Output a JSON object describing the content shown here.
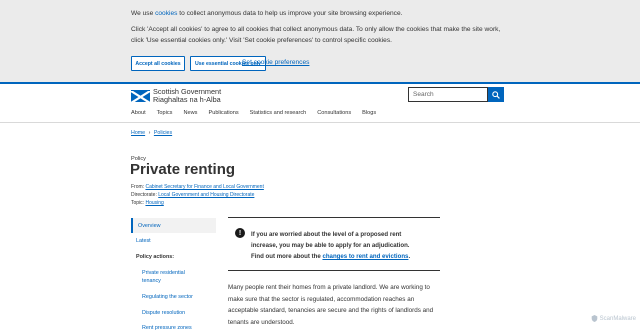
{
  "cookie_banner": {
    "line1_pre": "We use ",
    "line1_link": "cookies",
    "line1_post": " to collect anonymous data to help us improve your site browsing experience.",
    "line2": "Click 'Accept all cookies' to agree to all cookies that collect anonymous data. To only allow the cookies that make the site work,",
    "line3": "click 'Use essential cookies only.' Visit 'Set cookie preferences' to control specific cookies.",
    "accept_label": "Accept all cookies",
    "essential_label": "Use essential cookies only",
    "preferences_label": "Set cookie preferences"
  },
  "header": {
    "logo_line1": "Scottish Government",
    "logo_line2": "Riaghaltas na h-Alba",
    "search_placeholder": "Search"
  },
  "nav": [
    "About",
    "Topics",
    "News",
    "Publications",
    "Statistics and research",
    "Consultations",
    "Blogs"
  ],
  "breadcrumb": {
    "home": "Home",
    "sep": "›",
    "current": "Policies"
  },
  "page": {
    "label": "Policy",
    "title": "Private renting",
    "from_label": "From: ",
    "from_value": "Cabinet Secretary for Finance and Local Government",
    "directorate_label": "Directorate: ",
    "directorate_value": "Local Government and Housing Directorate",
    "topic_label": "Topic: ",
    "topic_value": "Housing"
  },
  "sidebar": {
    "overview": "Overview",
    "latest": "Latest",
    "actions_heading": "Policy actions:",
    "actions": [
      "Private residential",
      "tenancy",
      "Regulating the sector",
      "Dispute resolution",
      "Rent pressure zones"
    ]
  },
  "alert": {
    "line1": "If you are worried about the level of a proposed rent",
    "line2": "increase, you may be able to apply for an adjudication.",
    "line3_pre": "Find out more about the ",
    "line3_link": "changes to rent and evictions",
    "line3_post": "."
  },
  "body": {
    "line1": "Many people rent their homes from a private landlord. We are working to",
    "line2": "make sure that the sector is regulated, accommodation reaches an",
    "line3": "acceptable standard, tenancies are secure and the rights of landlords and",
    "line4": "tenants are understood."
  },
  "watermark": "ScanMalware",
  "colors": {
    "brand_blue": "#0065bd",
    "banner_bg": "#ebebeb",
    "text": "#333333"
  }
}
